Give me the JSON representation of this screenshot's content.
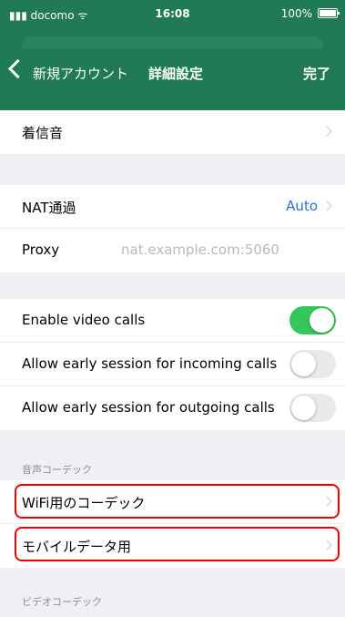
{
  "status_bar": {
    "carrier": "docomo",
    "time": "16:08",
    "battery": "100%"
  },
  "nav": {
    "back_label": "新規アカウント",
    "title": "詳細設定",
    "done_label": "完了"
  },
  "ringtone": {
    "label": "着信音"
  },
  "nat": {
    "label": "NAT通過",
    "value": "Auto"
  },
  "proxy": {
    "label": "Proxy",
    "placeholder": "nat.example.com:5060"
  },
  "toggles": [
    {
      "label": "Enable video calls",
      "on": true
    },
    {
      "label": "Allow early session for incoming calls",
      "on": false
    },
    {
      "label": "Allow early session for outgoing calls",
      "on": false
    }
  ],
  "audio_codec": {
    "header": "音声コーデック",
    "items": [
      {
        "label": "WiFi用のコーデック"
      },
      {
        "label": "モバイルデータ用"
      }
    ]
  },
  "video_codec": {
    "header": "ビデオコーデック"
  }
}
